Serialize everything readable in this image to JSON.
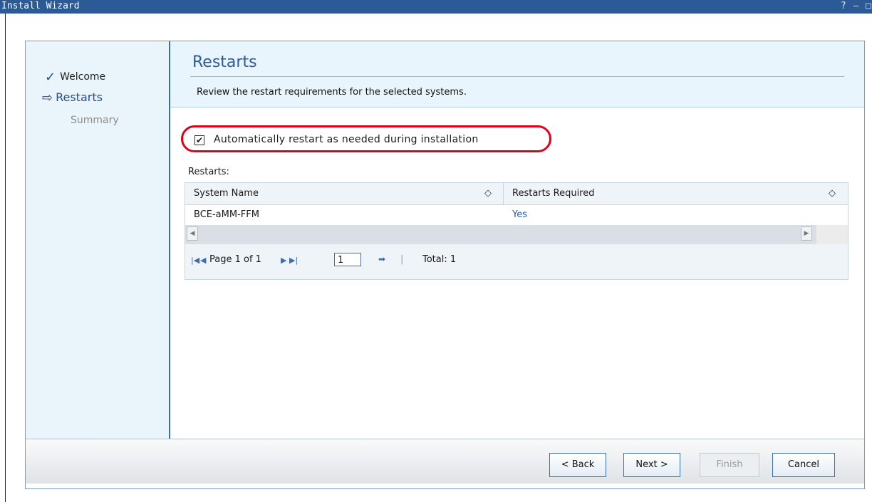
{
  "window": {
    "title": "Install Wizard",
    "controls": "? – □"
  },
  "nav": {
    "items": [
      {
        "label": "Welcome",
        "state": "done",
        "icon": "check-icon"
      },
      {
        "label": "Restarts",
        "state": "current",
        "icon": "arrow-right-icon"
      },
      {
        "label": "Summary",
        "state": "pending"
      }
    ]
  },
  "header": {
    "title": "Restarts",
    "description": "Review the restart requirements for the selected systems."
  },
  "options": {
    "auto_restart_label": "Automatically restart as needed during installation",
    "auto_restart_checked": true,
    "checkbox_mark": "✔"
  },
  "table": {
    "label": "Restarts:",
    "columns": [
      "System Name",
      "Restarts Required"
    ],
    "rows": [
      {
        "system_name": "BCE-aMM-FFM",
        "restarts_required": "Yes"
      }
    ]
  },
  "pager": {
    "page_text": "Page 1 of 1",
    "page_input": "1",
    "total_text": "Total: 1"
  },
  "buttons": {
    "back": "< Back",
    "next": "Next >",
    "finish": "Finish",
    "cancel": "Cancel"
  },
  "colors": {
    "title_bar": "#2c5a97",
    "accent": "#2f5b94",
    "highlight": "#e0001b",
    "link": "#2a5fa8"
  }
}
